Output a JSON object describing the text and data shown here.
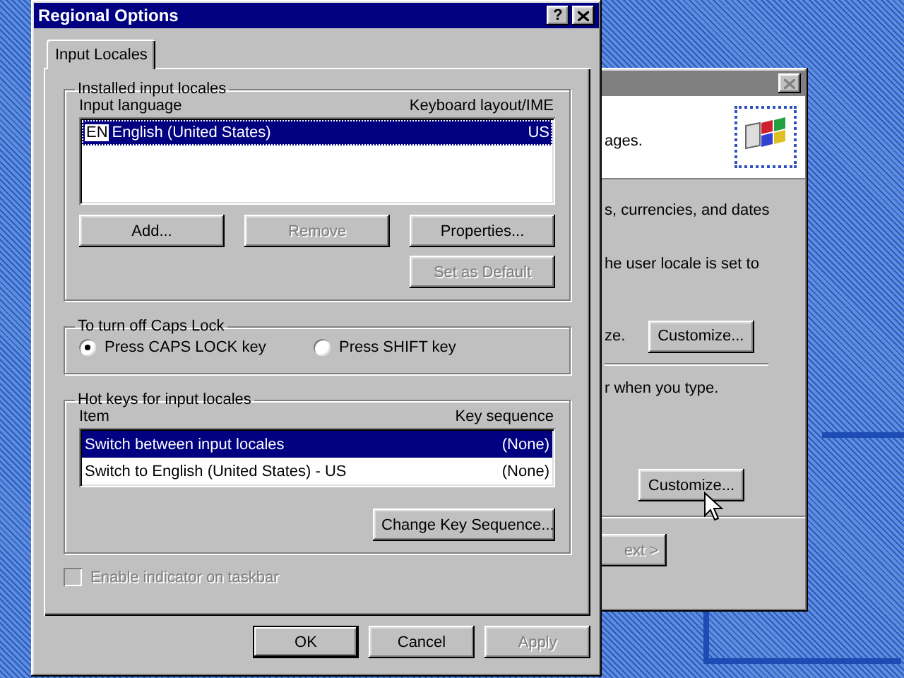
{
  "background_window": {
    "header_text": "ages.",
    "items": [
      {
        "kind": "text",
        "text": "s, currencies, and dates"
      },
      {
        "kind": "text",
        "text": "he user locale is set to"
      },
      {
        "kind": "text_button",
        "text": "ze.",
        "button": "Customize..."
      },
      {
        "kind": "separator"
      },
      {
        "kind": "text",
        "text": "r when you type."
      },
      {
        "kind": "button",
        "button": "Customize...",
        "cursor": true
      }
    ],
    "next_button": {
      "label": "ext >",
      "disabled": true
    }
  },
  "dialog": {
    "title": "Regional Options",
    "help_button": "?",
    "tabs": [
      {
        "label": "Input Locales",
        "selected": true
      }
    ],
    "installed": {
      "title": "Installed input locales",
      "columns": [
        "Input language",
        "Keyboard layout/IME"
      ],
      "rows": [
        {
          "badge": "EN",
          "language": "English (United States)",
          "layout": "US",
          "selected": true
        }
      ],
      "buttons": [
        {
          "label": "Add...",
          "disabled": false
        },
        {
          "label": "Remove",
          "disabled": true
        },
        {
          "label": "Properties...",
          "disabled": false
        },
        {
          "label": "Set as Default",
          "disabled": true
        }
      ]
    },
    "caps_lock": {
      "title": "To turn off Caps Lock",
      "options": [
        {
          "label": "Press CAPS LOCK key",
          "selected": true
        },
        {
          "label": "Press SHIFT key",
          "selected": false
        }
      ]
    },
    "hot_keys": {
      "title": "Hot keys for input locales",
      "columns": [
        "Item",
        "Key sequence"
      ],
      "rows": [
        {
          "item": "Switch between input locales",
          "sequence": "(None)",
          "selected": true
        },
        {
          "item": "Switch to English (United States) - US",
          "sequence": "(None)",
          "selected": false
        }
      ],
      "button": "Change Key Sequence..."
    },
    "taskbar_indicator": {
      "label": "Enable indicator on taskbar",
      "checked": false,
      "disabled": true
    },
    "buttons": [
      {
        "label": "OK",
        "default": true,
        "disabled": false
      },
      {
        "label": "Cancel",
        "default": false,
        "disabled": false
      },
      {
        "label": "Apply",
        "default": false,
        "disabled": true
      }
    ]
  }
}
